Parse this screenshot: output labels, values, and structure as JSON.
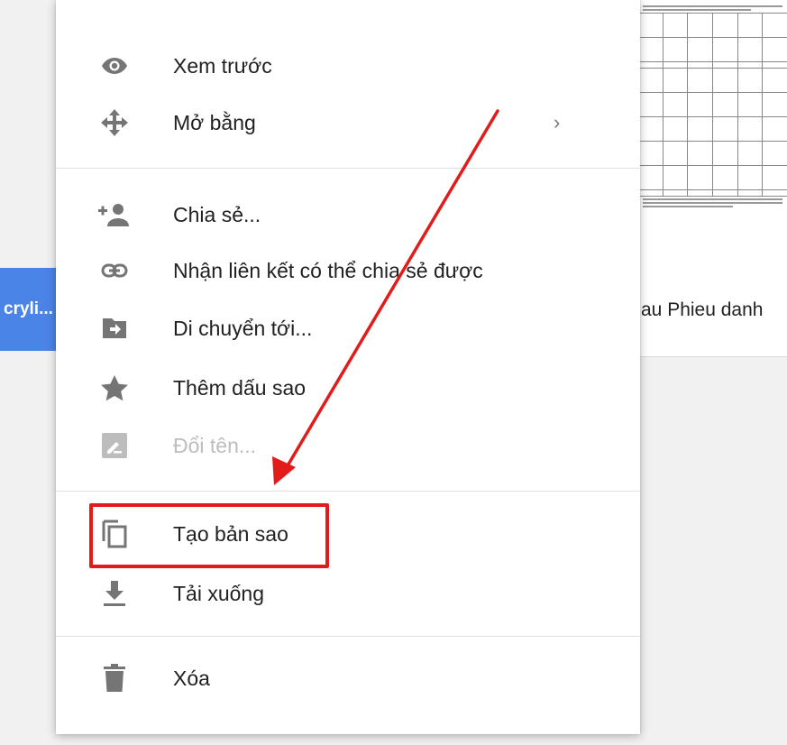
{
  "background": {
    "file_chip_label": "cryli...",
    "file_title": "au Phieu danh"
  },
  "menu": {
    "items": [
      {
        "label": "Xem trước",
        "icon": "eye-icon"
      },
      {
        "label": "Mở bằng",
        "icon": "open-with-icon",
        "submenu_arrow": "›"
      },
      {
        "label": "Chia sẻ...",
        "icon": "person-add-icon"
      },
      {
        "label": "Nhận liên kết có thể chia sẻ được",
        "icon": "link-icon"
      },
      {
        "label": "Di chuyển tới...",
        "icon": "folder-move-icon"
      },
      {
        "label": "Thêm dấu sao",
        "icon": "star-icon"
      },
      {
        "label": "Đổi tên...",
        "icon": "rename-icon",
        "disabled": true
      },
      {
        "label": "Tạo bản sao",
        "icon": "copy-icon",
        "highlighted": true
      },
      {
        "label": "Tải xuống",
        "icon": "download-icon"
      },
      {
        "label": "Xóa",
        "icon": "trash-icon"
      }
    ]
  },
  "colors": {
    "annotation_red": "#e21b1b",
    "icon_gray": "#757575",
    "chip_blue": "#4a84e6"
  }
}
